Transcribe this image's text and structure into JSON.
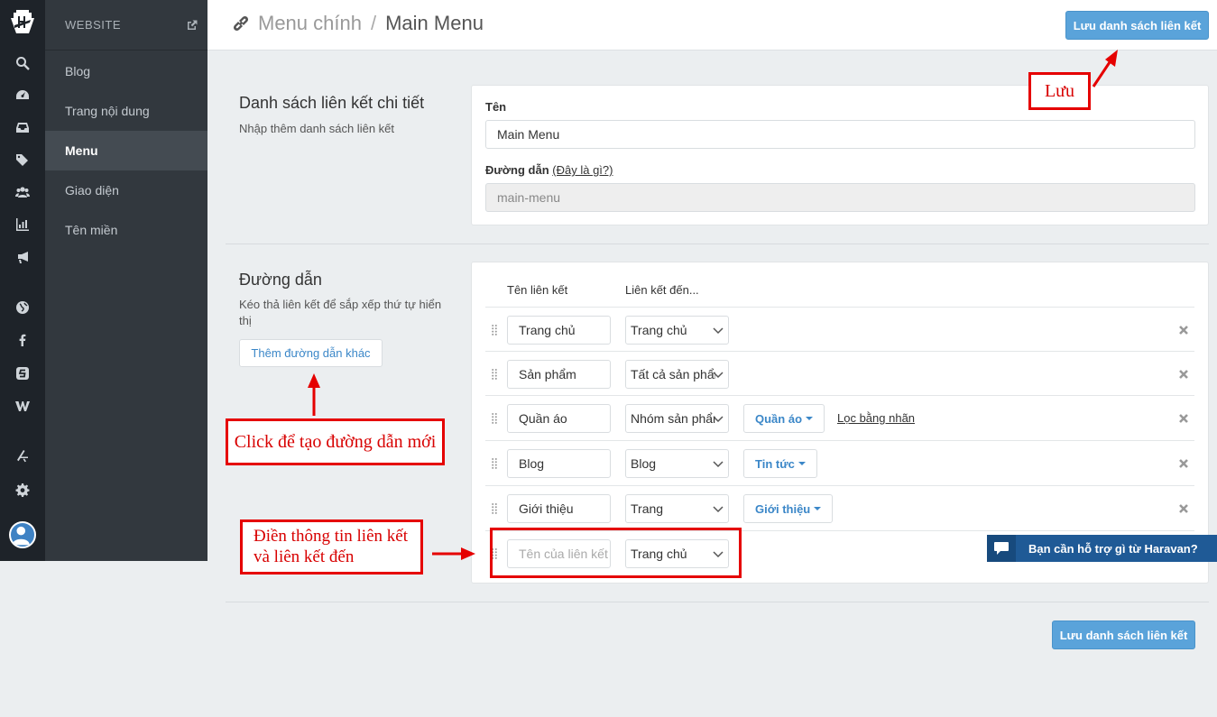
{
  "sidebar": {
    "header": "WEBSITE",
    "items": [
      {
        "label": "Blog"
      },
      {
        "label": "Trang nội dung"
      },
      {
        "label": "Menu"
      },
      {
        "label": "Giao diện"
      },
      {
        "label": "Tên miền"
      }
    ]
  },
  "header": {
    "breadcrumb_parent": "Menu chính",
    "breadcrumb_sep": "/",
    "breadcrumb_current": "Main Menu",
    "save_label": "Lưu danh sách liên kết"
  },
  "details": {
    "title": "Danh sách liên kết chi tiết",
    "desc": "Nhập thêm danh sách liên kết",
    "name_label": "Tên",
    "name_value": "Main Menu",
    "handle_label": "Đường dẫn",
    "handle_help": "(Đây là gì?)",
    "handle_value": "main-menu"
  },
  "links": {
    "title": "Đường dẫn",
    "desc": "Kéo thả liên kết để sắp xếp thứ tự hiển thị",
    "add_label": "Thêm đường dẫn khác",
    "col_name": "Tên liên kết",
    "col_target": "Liên kết đến...",
    "rows": [
      {
        "name": "Trang chủ",
        "target": "Trang chủ"
      },
      {
        "name": "Sản phẩm",
        "target": "Tất cả sản phẩm"
      },
      {
        "name": "Quần áo",
        "target": "Nhóm sản phẩm",
        "sub": "Quần áo",
        "filter": "Lọc bằng nhãn"
      },
      {
        "name": "Blog",
        "target": "Blog",
        "sub": "Tin tức"
      },
      {
        "name": "Giới thiệu",
        "target": "Trang",
        "sub": "Giới thiệu"
      }
    ],
    "new_row": {
      "placeholder": "Tên của liên kết",
      "target": "Trang chủ"
    }
  },
  "footer": {
    "save_label": "Lưu danh sách liên kết"
  },
  "annotations": {
    "save": "Lưu",
    "add": "Click để tạo đường dẫn mới",
    "fill_line1": "Điền thông tin liên kết",
    "fill_line2": "và liên kết đến"
  },
  "chat": {
    "label": "Bạn cần hỗ trợ gì từ Haravan?"
  },
  "colors": {
    "accent": "#5aa3da",
    "sidebar": "#32383e",
    "rail": "#1e2329",
    "annotation": "#e50000",
    "chat": "#1f5a96"
  }
}
